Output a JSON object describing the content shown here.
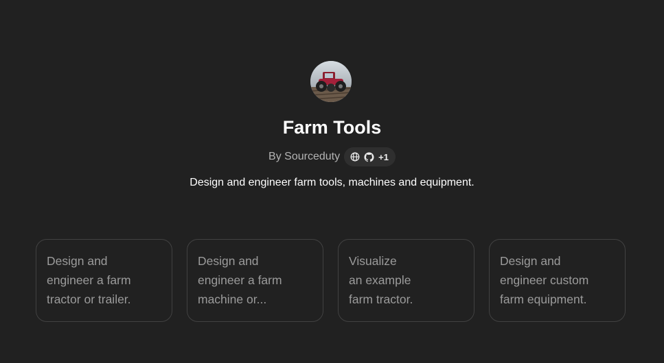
{
  "gpt": {
    "name": "Farm Tools",
    "byline": "By Sourceduty",
    "extra_links": "+1",
    "description": "Design and engineer farm tools, machines and equipment.",
    "avatar_icon": "tractor-avatar",
    "badge_icons": [
      "globe-icon",
      "github-icon"
    ]
  },
  "conversation_starters": [
    {
      "lines": [
        "Design and",
        "engineer a farm",
        "tractor or trailer."
      ]
    },
    {
      "lines": [
        "Design and",
        "engineer a farm",
        "machine or..."
      ]
    },
    {
      "lines": [
        "Visualize",
        "an example",
        "farm tractor."
      ]
    },
    {
      "lines": [
        "Design and",
        "engineer custom",
        "farm equipment."
      ]
    }
  ],
  "colors": {
    "background": "#212121",
    "card_border": "#424242",
    "badge_bg": "#2f2f2f",
    "muted_text": "#9b9b9b"
  }
}
